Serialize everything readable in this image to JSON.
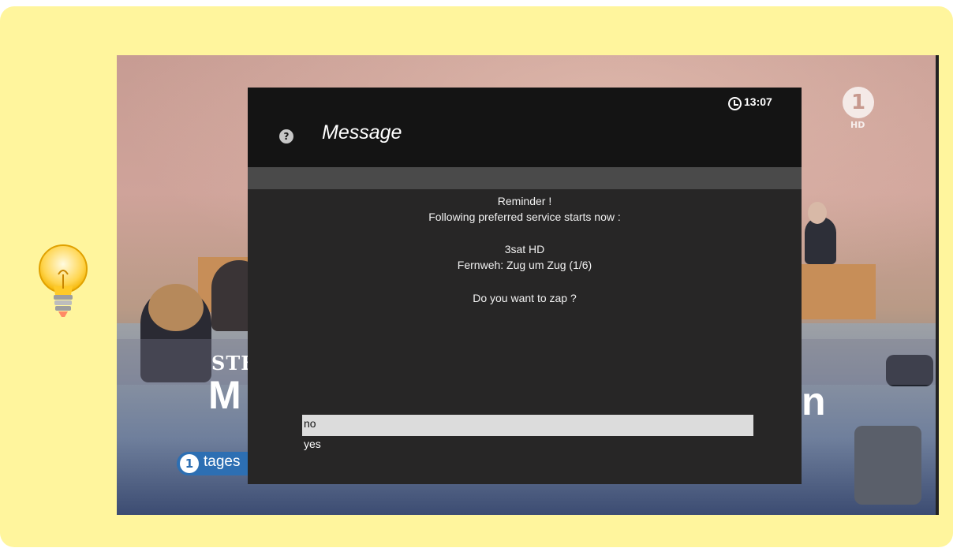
{
  "dialog": {
    "title": "Message",
    "help_icon": "?",
    "clock_icon": "clock-icon",
    "time": "13:07",
    "lines": [
      "Reminder !",
      "Following preferred service starts now :",
      "3sat HD",
      "Fernweh: Zug um Zug (1/6)",
      "Do you want to zap ?"
    ],
    "options": [
      "no",
      "yes"
    ],
    "selected_option": "no"
  },
  "background_tv": {
    "ticker_sub": "STE",
    "ticker_main": "M",
    "ticker_tail": "n",
    "news_brand": "tages",
    "channel_logo": "1",
    "channel_logo_sub": "HD"
  },
  "colors": {
    "note_background": "#fff59d",
    "dialog_background": "#272626",
    "header_background": "#141414",
    "selection_highlight": "#dcdcdc"
  }
}
